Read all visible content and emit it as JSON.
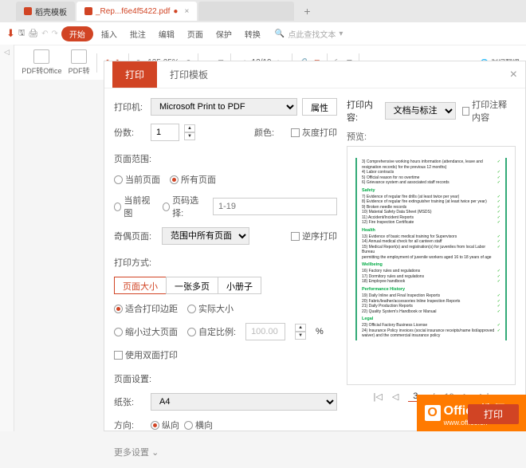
{
  "tabs": [
    {
      "label": "稻壳模板"
    },
    {
      "label": "_Rep...f6e4f5422.pdf"
    },
    {
      "label": ""
    }
  ],
  "menu": {
    "start": "开始",
    "items": [
      "插入",
      "批注",
      "编辑",
      "页面",
      "保护",
      "转换"
    ],
    "search_placeholder": "点此查找文本",
    "translate": "划词翻译"
  },
  "toolbar": {
    "pdf_office": "PDF转Office",
    "pdf_other": "PDF转",
    "zoom": "125.25%",
    "page_current": "12",
    "page_total": "19"
  },
  "dialog": {
    "tab_print": "打印",
    "tab_template": "打印模板",
    "printer_label": "打印机:",
    "printer_value": "Microsoft Print to PDF",
    "properties_btn": "属性",
    "copies_label": "份数:",
    "copies_value": "1",
    "color_label": "颜色:",
    "grayscale_label": "灰度打印",
    "content_label": "打印内容:",
    "content_value": "文档与标注",
    "annotate_label": "打印注释内容",
    "preview_label": "预览:",
    "range_title": "页面范围:",
    "range_current": "当前页面",
    "range_all": "所有页面",
    "range_view": "当前视图",
    "range_select": "页码选择:",
    "range_placeholder": "1-19",
    "subset_label": "奇偶页面:",
    "subset_value": "范围中所有页面",
    "reverse_label": "逆序打印",
    "method_title": "打印方式:",
    "method_size": "页面大小",
    "method_multi": "一张多页",
    "method_booklet": "小册子",
    "fit_margin": "适合打印边距",
    "fit_actual": "实际大小",
    "fit_shrink": "缩小过大页面",
    "fit_custom": "自定比例:",
    "fit_custom_val": "100.00",
    "fit_pct": "%",
    "duplex_label": "使用双面打印",
    "page_setup_title": "页面设置:",
    "paper_label": "纸张:",
    "paper_value": "A4",
    "orient_label": "方向:",
    "orient_portrait": "纵向",
    "orient_landscape": "横向",
    "more_settings": "更多设置",
    "print_btn": "打印"
  },
  "preview_doc": {
    "lines1": [
      "3) Comprehensive working hours information (attendance, leave and",
      "resignation records) for the previous 12 months)",
      "4) Labor contracts",
      "5) Official reason for no overtime",
      "6) Grievance system and associated staff records"
    ],
    "sec_safety": "Safety",
    "lines2": [
      "7) Evidence of regular fire drills (at least twice per year)",
      "8) Evidence of regular fire extinguisher training (at least twice per year)",
      "9) Broken needle records",
      "10) Material Safety Data Sheet (MSDS)",
      "11) Accident/Incident Reports",
      "12) Fire Inspection Certificate"
    ],
    "sec_health": "Health",
    "lines3": [
      "13) Evidence of basic medical training for Supervisors",
      "14) Annual medical check for all canteen staff",
      "15) Medical Report(s) and registration(s) for juveniles from local Labor Bureau",
      "permitting the employment of juvenile workers aged 16 to 18 years of age"
    ],
    "sec_wellbeing": "Wellbeing",
    "lines4": [
      "16) Factory rules and regulations",
      "17) Dormitory rules and regulations",
      "18) Employee handbook"
    ],
    "sec_perf": "Performance History",
    "lines5": [
      "19) Daily Inline and Final Inspection Reports",
      "20) Fabric/leather/accessories Inline Inspection Reports",
      "21) Daily Production Reports",
      "22) Quality System's Handbook or Manual"
    ],
    "sec_legal": "Legal",
    "lines6": [
      "23) Official Factory Business License",
      "24) Insurance Policy invoices (social insurance receipts/name list/approved",
      "waiver) and the commercial insurance policy"
    ]
  },
  "pagination": {
    "current": "3",
    "total": "19"
  },
  "watermark": {
    "text": "Office教程网",
    "sub": "www.office.cn"
  }
}
